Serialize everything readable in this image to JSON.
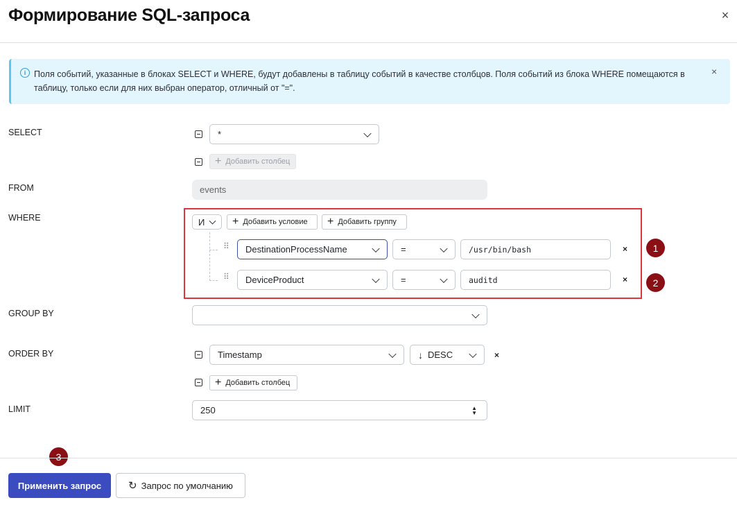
{
  "dialog": {
    "title": "Формирование SQL-запроса",
    "close_icon": "×"
  },
  "info": {
    "icon": "i",
    "text": "Поля событий, указанные в блоках SELECT и WHERE, будут добавлены в таблицу событий в качестве столбцов. Поля событий из блока WHERE помещаются в таблицу, только если для них выбран оператор, отличный от \"=\".",
    "close_icon": "×"
  },
  "select": {
    "label": "SELECT",
    "value": "*",
    "add_column_label": "Добавить столбец"
  },
  "from": {
    "label": "FROM",
    "value": "events"
  },
  "where": {
    "label": "WHERE",
    "logic": "И",
    "add_condition_label": "Добавить условие",
    "add_group_label": "Добавить группу",
    "conditions": [
      {
        "field": "DestinationProcessName",
        "operator": "=",
        "value": "/usr/bin/bash",
        "remove": "×",
        "badge": "1"
      },
      {
        "field": "DeviceProduct",
        "operator": "=",
        "value": "auditd",
        "remove": "×",
        "badge": "2"
      }
    ]
  },
  "group_by": {
    "label": "GROUP BY",
    "value": ""
  },
  "order_by": {
    "label": "ORDER BY",
    "field": "Timestamp",
    "direction_icon": "↓",
    "direction": "DESC",
    "remove": "×",
    "add_column_label": "Добавить столбец"
  },
  "limit": {
    "label": "LIMIT",
    "value": "250"
  },
  "footer": {
    "badge": "3",
    "apply_label": "Применить запрос",
    "default_icon": "↻",
    "default_label": "Запрос по умолчанию"
  },
  "colors": {
    "primary": "#3b4cc0",
    "annotation_red": "#d9363e",
    "badge": "#8b1016",
    "info_bg": "#e3f5fd",
    "info_border": "#5cc6ef"
  }
}
